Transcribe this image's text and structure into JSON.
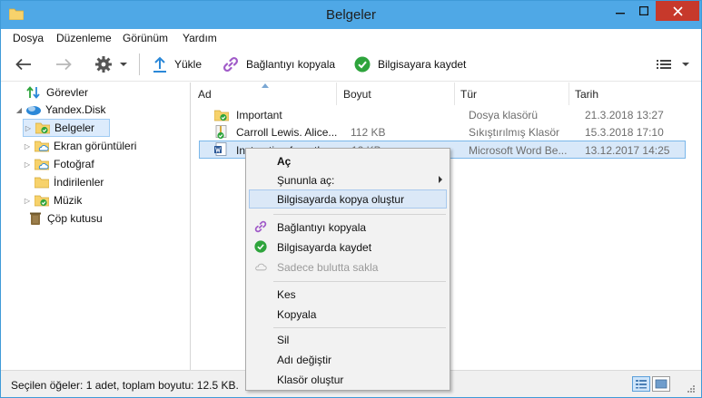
{
  "window": {
    "title": "Belgeler"
  },
  "menu": [
    "Dosya",
    "Düzenleme",
    "Görünüm",
    "Yardım"
  ],
  "toolbar": {
    "upload": "Yükle",
    "copy_link": "Bağlantıyı kopyala",
    "save_to_computer": "Bilgisayara kaydet"
  },
  "tree": [
    {
      "label": "Görevler",
      "icon": "tasks-arrows-icon"
    },
    {
      "label": "Yandex.Disk",
      "icon": "cloud-disk-icon"
    },
    {
      "label": "Belgeler",
      "icon": "folder-check-icon"
    },
    {
      "label": "Ekran görüntüleri",
      "icon": "folder-cloud-icon"
    },
    {
      "label": "Fotoğraf",
      "icon": "folder-cloud-icon"
    },
    {
      "label": "İndirilenler",
      "icon": "folder-icon"
    },
    {
      "label": "Müzik",
      "icon": "folder-check-icon"
    },
    {
      "label": "Çöp kutusu",
      "icon": "trash-icon"
    }
  ],
  "columns": {
    "name": "Ad",
    "size": "Boyut",
    "type": "Tür",
    "date": "Tarih"
  },
  "files": [
    {
      "name": "Important",
      "size": "",
      "type": "Dosya klasörü",
      "date": "21.3.2018 13:27"
    },
    {
      "name": "Carroll Lewis. Alice...",
      "size": "112 KB",
      "type": "Sıkıştırılmış Klasör",
      "date": "15.3.2018 17:10"
    },
    {
      "name": "Instruction from th...",
      "size": "12 KB",
      "type": "Microsoft Word Be...",
      "date": "13.12.2017 14:25"
    }
  ],
  "context_menu": {
    "open": "Aç",
    "open_with": "Şununla aç:",
    "create_copy": "Bilgisayarda kopya oluştur",
    "copy_link": "Bağlantıyı kopyala",
    "save_to_computer": "Bilgisayarda kaydet",
    "cloud_only": "Sadece bulutta sakla",
    "cut": "Kes",
    "copy": "Kopyala",
    "delete": "Sil",
    "rename": "Adı değiştir",
    "new_folder": "Klasör oluştur"
  },
  "status": {
    "text": "Seçilen öğeler: 1 adet, toplam boyutu: 12.5 KB."
  },
  "colors": {
    "titlebar": "#4fa8e6",
    "close": "#c7392b",
    "link_purple": "#a05ac8",
    "check_green": "#2ea43c",
    "upload_blue": "#2b88d8"
  }
}
